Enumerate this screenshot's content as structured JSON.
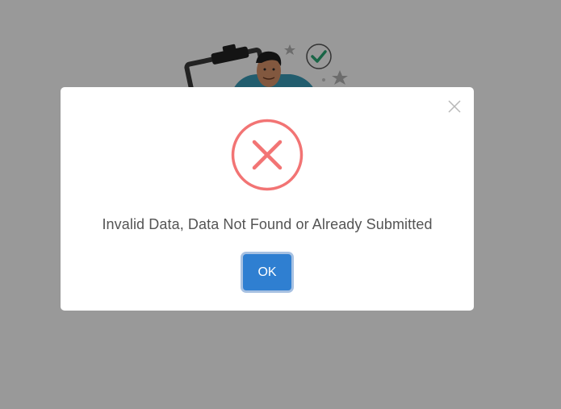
{
  "dialog": {
    "message": "Invalid Data, Data Not Found or Already Submitted",
    "ok_label": "OK",
    "icon": "error-x-icon",
    "close_icon": "close-icon"
  },
  "colors": {
    "overlay": "#9e9e9e",
    "error": "#f27474",
    "button": "#2f7fd1",
    "message_text": "#545454"
  }
}
